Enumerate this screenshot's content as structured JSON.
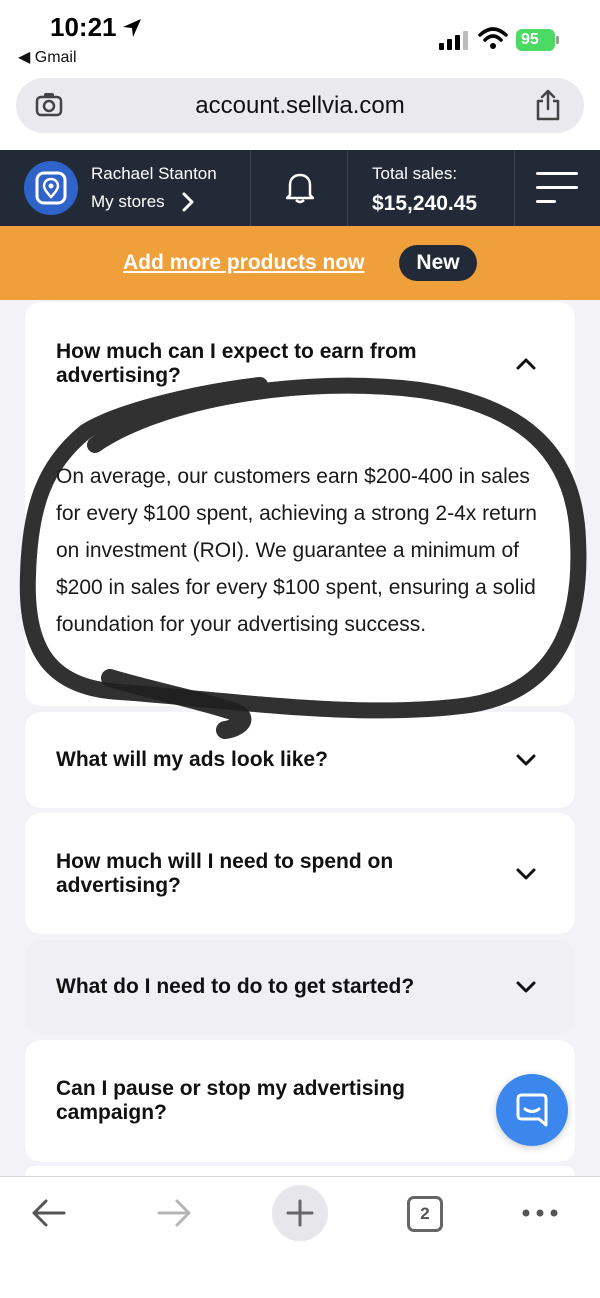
{
  "status_bar": {
    "time": "10:21",
    "back_app": "◀ Gmail",
    "battery": "95"
  },
  "browser": {
    "url": "account.sellvia.com",
    "tab_count": "2"
  },
  "header": {
    "user_name": "Rachael Stanton",
    "my_stores": "My stores",
    "total_label": "Total sales:",
    "total_value": "$15,240.45"
  },
  "promo": {
    "link": "Add more products now",
    "badge": "New"
  },
  "faq": [
    {
      "question": "How much can I expect to earn from advertising?",
      "answer": "On average, our customers earn $200-400 in sales for every $100 spent, achieving a strong 2-4x return on investment (ROI). We guarantee a minimum of $200 in sales for every $100 spent, ensuring a solid foundation for your advertising success.",
      "expanded": true
    },
    {
      "question": "What will my ads look like?",
      "expanded": false
    },
    {
      "question": "How much will I need to spend on advertising?",
      "expanded": false
    },
    {
      "question": "What do I need to do to get started?",
      "expanded": false
    },
    {
      "question": "Can I pause or stop my advertising campaign?",
      "expanded": false
    }
  ],
  "colors": {
    "header_bg": "#232a37",
    "promo_bg": "#f0a03a",
    "accent_blue": "#3b87ed",
    "battery_green": "#4cd964"
  },
  "icons": [
    "location-arrow-icon",
    "signal-icon",
    "wifi-icon",
    "battery-icon",
    "page-settings-icon",
    "share-icon",
    "store-logo-icon",
    "chevron-right-icon",
    "bell-icon",
    "hamburger-menu-icon",
    "chevron-up-icon",
    "chevron-down-icon",
    "chat-icon",
    "back-arrow-icon",
    "forward-arrow-icon",
    "plus-icon",
    "more-icon"
  ]
}
